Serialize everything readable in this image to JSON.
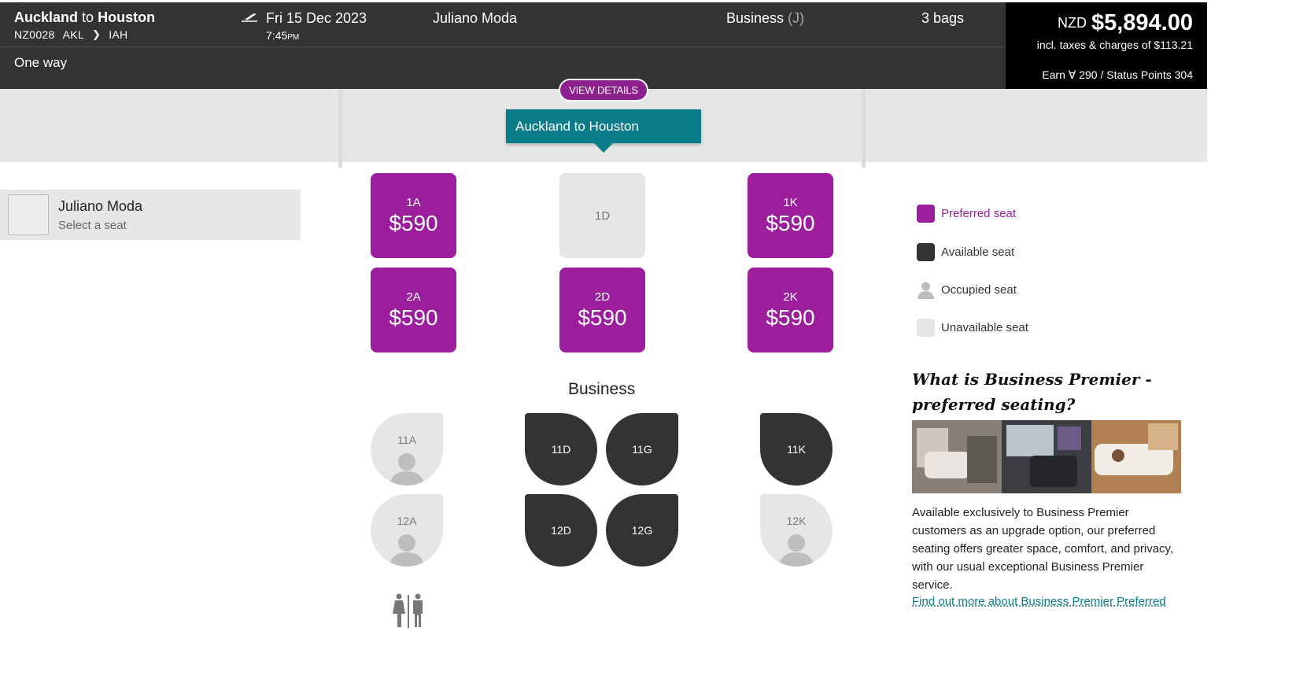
{
  "header": {
    "origin": "Auckland",
    "to_word": "to",
    "destination": "Houston",
    "flight_number": "NZ0028",
    "from_code": "AKL",
    "to_code": "IAH",
    "trip_type": "One way",
    "date": "Fri 15 Dec 2023",
    "time": "7:45",
    "time_suffix": "PM",
    "passenger": "Juliano Moda",
    "cabin": "Business",
    "cabin_code": "(J)",
    "bags": "3 bags",
    "plane_icon": "plane-departure-icon"
  },
  "price": {
    "currency": "NZD",
    "amount": "$5,894.00",
    "taxes": "incl. taxes & charges of $113.21",
    "earn": "Earn Ɐ 290 / Status Points 304"
  },
  "banner": {
    "view_details": "VIEW DETAILS",
    "flight_tab": "Auckland to Houston"
  },
  "passenger_panel": {
    "name": "Juliano Moda",
    "prompt": "Select a seat"
  },
  "seat_map": {
    "front_rows": [
      {
        "seat": "1A",
        "status": "preferred",
        "price": "$590"
      },
      {
        "seat": "1D",
        "status": "unavailable",
        "price": ""
      },
      {
        "seat": "1K",
        "status": "preferred",
        "price": "$590"
      },
      {
        "seat": "2A",
        "status": "preferred",
        "price": "$590"
      },
      {
        "seat": "2D",
        "status": "preferred",
        "price": "$590"
      },
      {
        "seat": "2K",
        "status": "preferred",
        "price": "$590"
      }
    ],
    "cabin_label": "Business",
    "pods": [
      {
        "seat": "11A",
        "status": "occupied"
      },
      {
        "seat": "11D",
        "status": "available"
      },
      {
        "seat": "11G",
        "status": "available"
      },
      {
        "seat": "11K",
        "status": "available"
      },
      {
        "seat": "12A",
        "status": "occupied"
      },
      {
        "seat": "12D",
        "status": "available"
      },
      {
        "seat": "12G",
        "status": "available"
      },
      {
        "seat": "12K",
        "status": "occupied"
      }
    ],
    "facility_icon": "toilet-icon"
  },
  "legend": {
    "preferred": "Preferred seat",
    "available": "Available seat",
    "occupied": "Occupied seat",
    "unavailable": "Unavailable seat"
  },
  "info": {
    "title": "What is Business Premier - preferred seating?",
    "body": "Available exclusively to Business Premier customers as an upgrade option, our preferred seating offers greater space, comfort, and privacy, with our usual exceptional Business Premier service.",
    "link": "Find out more about Business Premier Preferred"
  },
  "colors": {
    "preferred": "#9b1f9c",
    "available": "#333333",
    "unavailable": "#e6e6e6",
    "accent_teal": "#0b7d8a",
    "header_bg": "#333333",
    "price_bg": "#000000"
  }
}
